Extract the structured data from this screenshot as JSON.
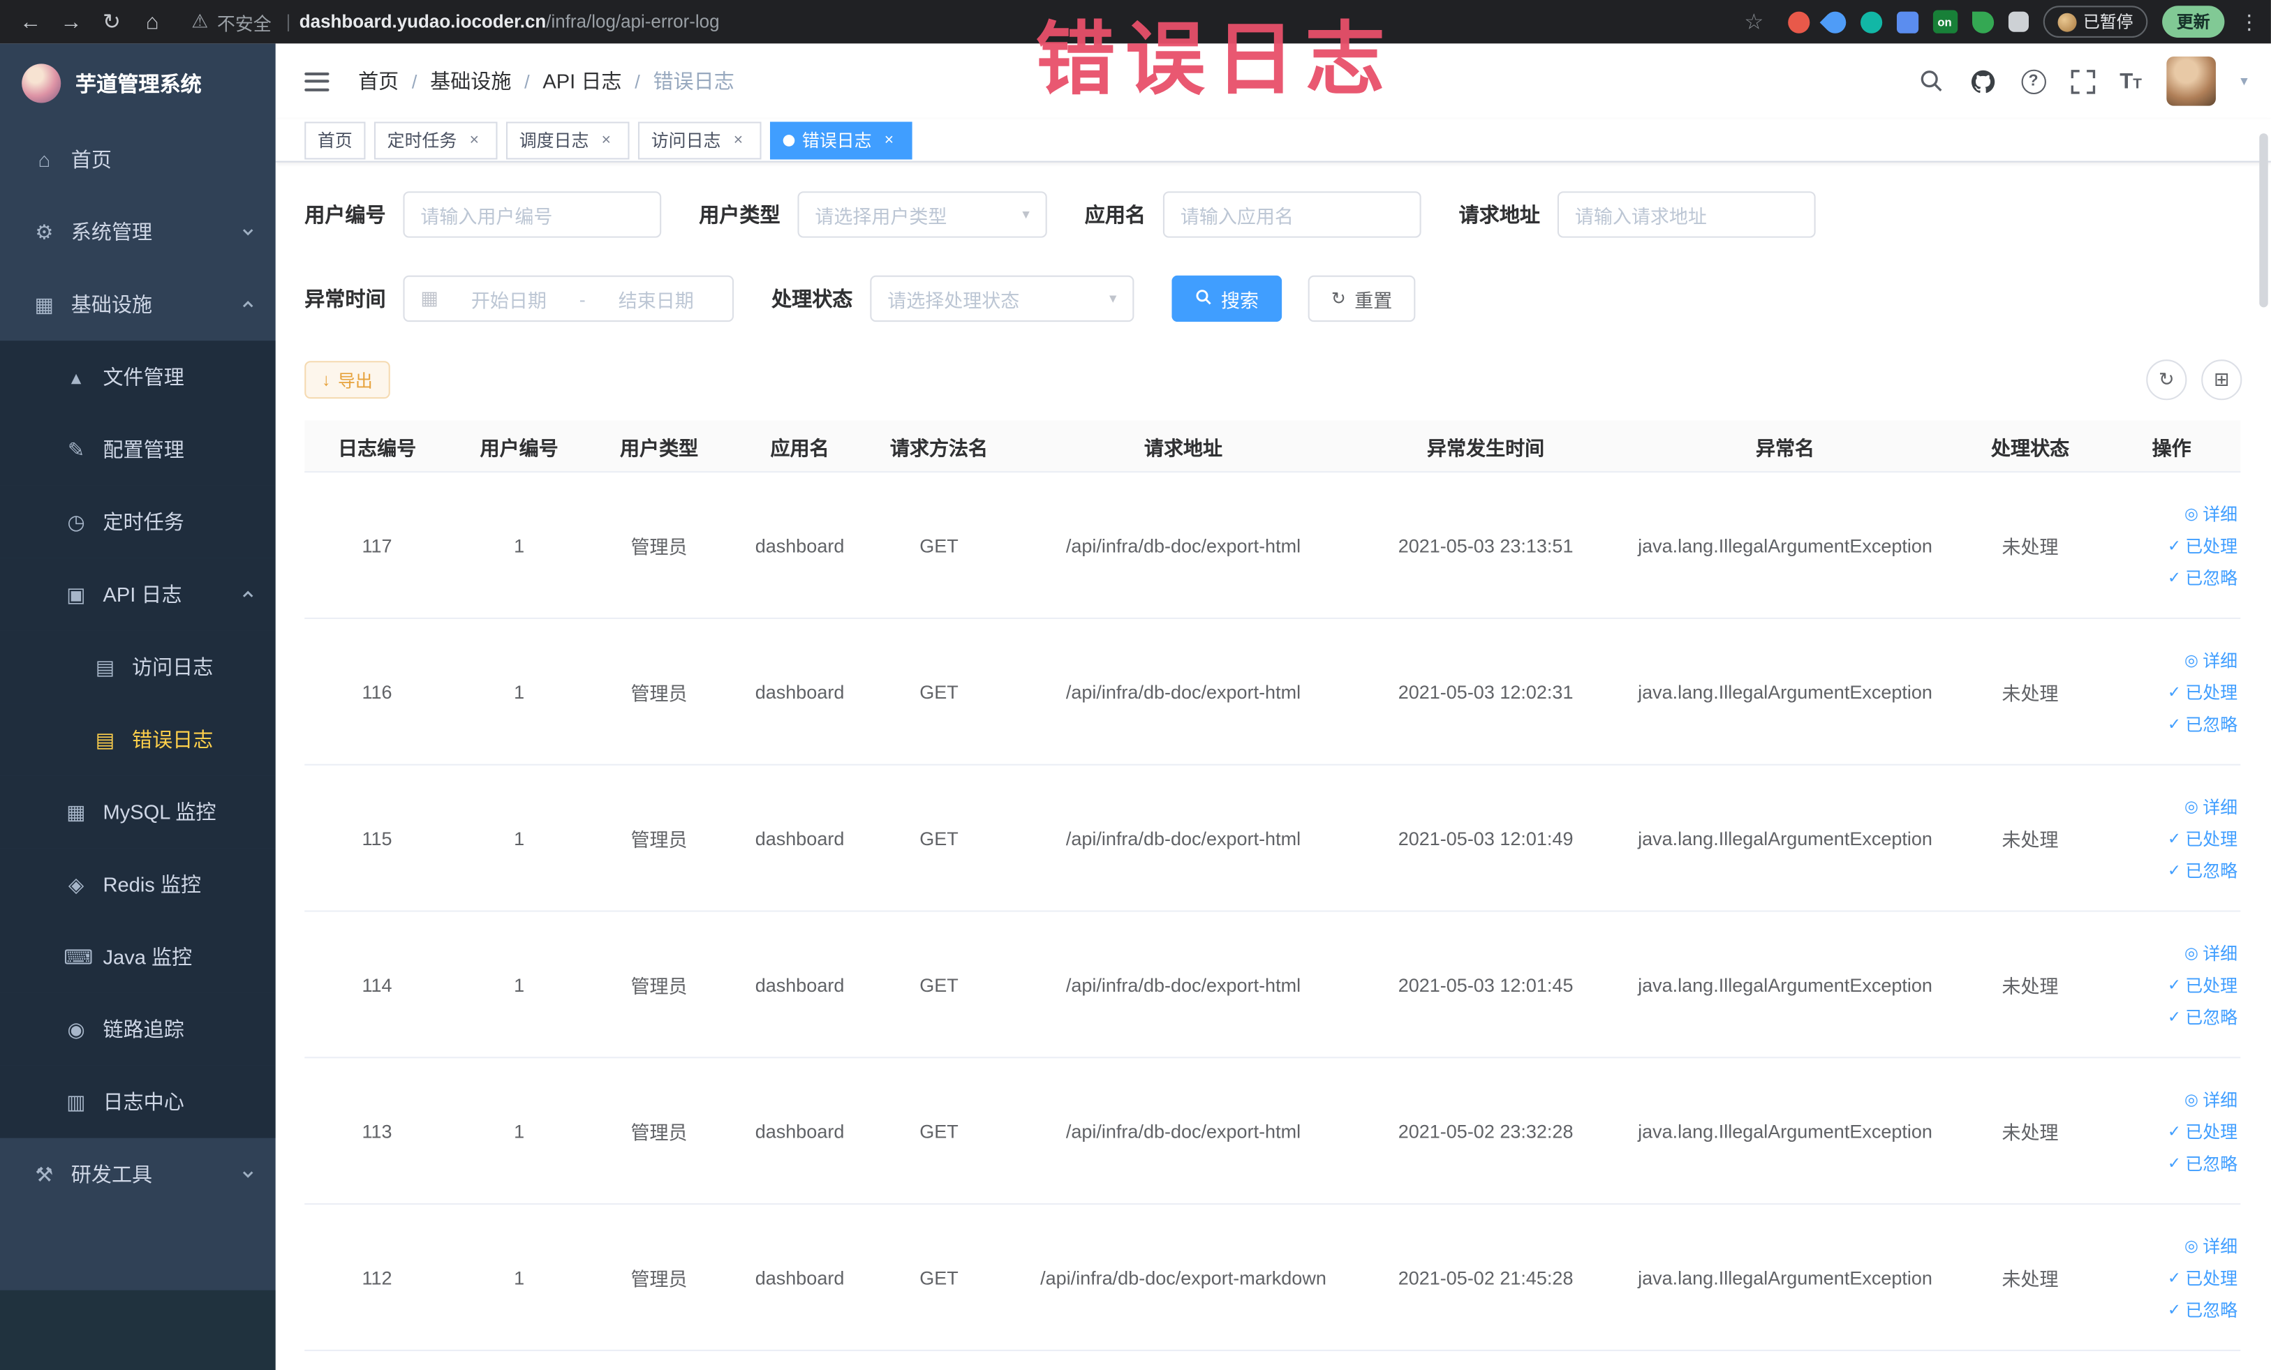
{
  "browser": {
    "security_label": "不安全",
    "url_host": "dashboard.yudao.iocoder.cn",
    "url_path": "/infra/log/api-error-log",
    "paused_badge": "已暂停",
    "update_button": "更新"
  },
  "annotation": {
    "text": "错误日志"
  },
  "sidebar": {
    "title": "芋道管理系统",
    "items": [
      {
        "label": "首页"
      },
      {
        "label": "系统管理"
      },
      {
        "label": "基础设施"
      },
      {
        "label": "文件管理"
      },
      {
        "label": "配置管理"
      },
      {
        "label": "定时任务"
      },
      {
        "label": "API 日志"
      },
      {
        "label": "访问日志"
      },
      {
        "label": "错误日志"
      },
      {
        "label": "MySQL 监控"
      },
      {
        "label": "Redis 监控"
      },
      {
        "label": "Java 监控"
      },
      {
        "label": "链路追踪"
      },
      {
        "label": "日志中心"
      },
      {
        "label": "研发工具"
      }
    ]
  },
  "breadcrumb": {
    "items": [
      "首页",
      "基础设施",
      "API 日志",
      "错误日志"
    ]
  },
  "tabs": [
    {
      "label": "首页"
    },
    {
      "label": "定时任务"
    },
    {
      "label": "调度日志"
    },
    {
      "label": "访问日志"
    },
    {
      "label": "错误日志"
    }
  ],
  "filters": {
    "user_id_label": "用户编号",
    "user_id_placeholder": "请输入用户编号",
    "user_type_label": "用户类型",
    "user_type_placeholder": "请选择用户类型",
    "app_name_label": "应用名",
    "app_name_placeholder": "请输入应用名",
    "request_url_label": "请求地址",
    "request_url_placeholder": "请输入请求地址",
    "exception_time_label": "异常时间",
    "date_start_placeholder": "开始日期",
    "date_separator": "-",
    "date_end_placeholder": "结束日期",
    "process_status_label": "处理状态",
    "process_status_placeholder": "请选择处理状态",
    "search_button": "搜索",
    "reset_button": "重置"
  },
  "toolbar": {
    "export_button": "导出"
  },
  "table": {
    "columns": [
      "日志编号",
      "用户编号",
      "用户类型",
      "应用名",
      "请求方法名",
      "请求地址",
      "异常发生时间",
      "异常名",
      "处理状态",
      "操作"
    ],
    "actions": {
      "detail": "详细",
      "processed": "已处理",
      "ignored": "已忽略"
    },
    "rows": [
      {
        "id": "117",
        "user_id": "1",
        "user_type": "管理员",
        "app": "dashboard",
        "method": "GET",
        "url": "/api/infra/db-doc/export-html",
        "time": "2021-05-03 23:13:51",
        "exception": "java.lang.IllegalArgumentException",
        "status": "未处理"
      },
      {
        "id": "116",
        "user_id": "1",
        "user_type": "管理员",
        "app": "dashboard",
        "method": "GET",
        "url": "/api/infra/db-doc/export-html",
        "time": "2021-05-03 12:02:31",
        "exception": "java.lang.IllegalArgumentException",
        "status": "未处理"
      },
      {
        "id": "115",
        "user_id": "1",
        "user_type": "管理员",
        "app": "dashboard",
        "method": "GET",
        "url": "/api/infra/db-doc/export-html",
        "time": "2021-05-03 12:01:49",
        "exception": "java.lang.IllegalArgumentException",
        "status": "未处理"
      },
      {
        "id": "114",
        "user_id": "1",
        "user_type": "管理员",
        "app": "dashboard",
        "method": "GET",
        "url": "/api/infra/db-doc/export-html",
        "time": "2021-05-03 12:01:45",
        "exception": "java.lang.IllegalArgumentException",
        "status": "未处理"
      },
      {
        "id": "113",
        "user_id": "1",
        "user_type": "管理员",
        "app": "dashboard",
        "method": "GET",
        "url": "/api/infra/db-doc/export-html",
        "time": "2021-05-02 23:32:28",
        "exception": "java.lang.IllegalArgumentException",
        "status": "未处理"
      },
      {
        "id": "112",
        "user_id": "1",
        "user_type": "管理员",
        "app": "dashboard",
        "method": "GET",
        "url": "/api/infra/db-doc/export-markdown",
        "time": "2021-05-02 21:45:28",
        "exception": "java.lang.IllegalArgumentException",
        "status": "未处理"
      }
    ]
  }
}
